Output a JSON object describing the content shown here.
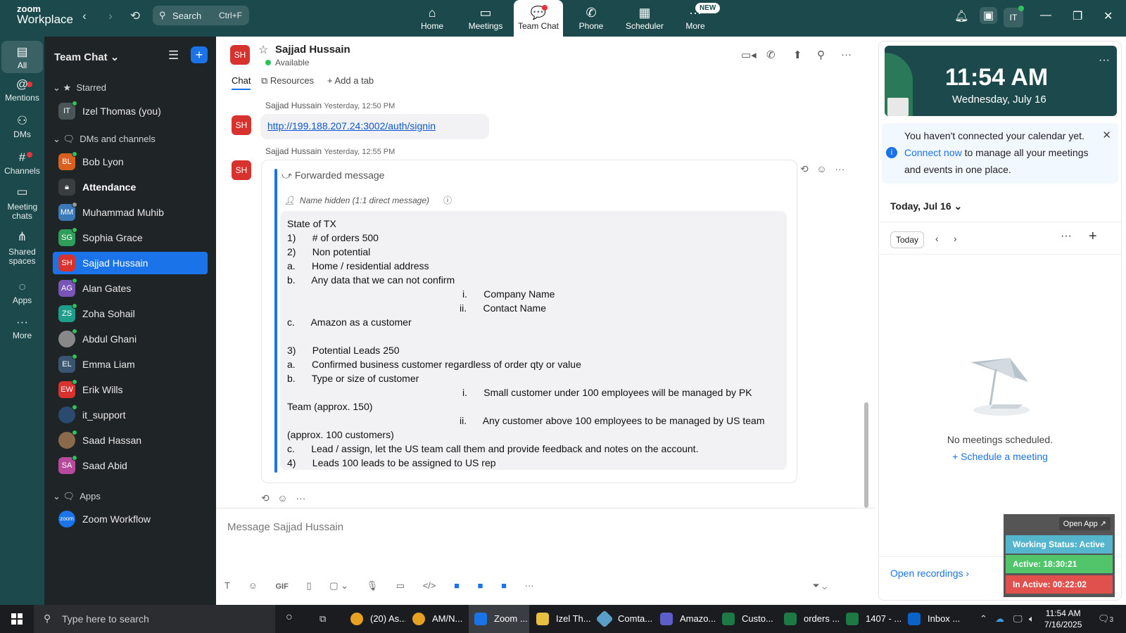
{
  "topbar": {
    "brand_line1": "zoom",
    "brand_line2": "Workplace",
    "search_label": "Search",
    "search_shortcut": "Ctrl+F",
    "nav": [
      {
        "label": "Home"
      },
      {
        "label": "Meetings"
      },
      {
        "label": "Team Chat"
      },
      {
        "label": "Phone"
      },
      {
        "label": "Scheduler"
      },
      {
        "label": "More"
      }
    ],
    "new_badge": "NEW",
    "avatar": "IT"
  },
  "rail": [
    {
      "label": "All"
    },
    {
      "label": "Mentions"
    },
    {
      "label": "DMs"
    },
    {
      "label": "Channels"
    },
    {
      "label": "Meeting chats"
    },
    {
      "label": "Shared spaces"
    },
    {
      "label": "Apps"
    },
    {
      "label": "More"
    }
  ],
  "sidebar": {
    "title": "Team Chat",
    "sections": {
      "starred": "Starred",
      "dms": "DMs and channels",
      "apps": "Apps"
    },
    "starred_items": [
      {
        "initials": "IT",
        "name": "Izel Thomas (you)",
        "color": "#4a5558"
      }
    ],
    "dm_items": [
      {
        "initials": "BL",
        "name": "Bob Lyon",
        "color": "#d9601e"
      },
      {
        "initials": "",
        "name": "Attendance",
        "color": "#3a3e40"
      },
      {
        "initials": "MM",
        "name": "Muhammad Muhib",
        "color": "#3a78b8"
      },
      {
        "initials": "SG",
        "name": "Sophia Grace",
        "color": "#2e9e5a"
      },
      {
        "initials": "SH",
        "name": "Sajjad Hussain",
        "color": "#d7322e"
      },
      {
        "initials": "AG",
        "name": "Alan Gates",
        "color": "#7a55b8"
      },
      {
        "initials": "ZS",
        "name": "Zoha Sohail",
        "color": "#1e9e8a"
      },
      {
        "initials": "",
        "name": "Abdul Ghani",
        "color": "#888888"
      },
      {
        "initials": "EL",
        "name": "Emma Liam",
        "color": "#3a5570"
      },
      {
        "initials": "EW",
        "name": "Erik Wills",
        "color": "#d7322e"
      },
      {
        "initials": "",
        "name": "it_support",
        "color": "#2a4a70"
      },
      {
        "initials": "",
        "name": "Saad Hassan",
        "color": "#8a6a4a"
      },
      {
        "initials": "SA",
        "name": "Saad Abid",
        "color": "#b84a9e"
      }
    ],
    "app_items": [
      {
        "initials": "zoom",
        "name": "Zoom Workflow",
        "color": "#1a73e8"
      }
    ]
  },
  "chat": {
    "header_initials": "SH",
    "name": "Sajjad Hussain",
    "status": "Available",
    "tabs": [
      "Chat",
      "Resources",
      "Add a tab"
    ],
    "messages": [
      {
        "sender": "Sajjad Hussain",
        "time": "Yesterday, 12:50 PM",
        "initials": "SH",
        "link": "http://199.188.207.24:3002/auth/signin"
      },
      {
        "sender": "Sajjad Hussain",
        "time": "Yesterday, 12:55 PM",
        "initials": "SH"
      }
    ],
    "forwarded_label": "Forwarded message",
    "forwarded_source": "Name hidden (1:1 direct message)",
    "forwarded_body": "State of TX\n1)      # of orders 500\n2)      Non potential\na.      Home / residential address\nb.      Any data that we can not confirm\n                                                                i.      Company Name\n                                                               ii.      Contact Name\nc.      Amazon as a customer\n\n3)      Potential Leads 250\na.      Confirmed business customer regardless of order qty or value\nb.      Type or size of customer\n                                                                i.      Small customer under 100 employees will be managed by PK\nTeam (approx. 150)\n                                                               ii.      Any customer above 100 employees to be managed by US team\n(approx. 100 customers)\nc.      Lead / assign, let the US team call them and provide feedback and notes on the account.\n4)      Leads 100 leads to be assigned to US rep",
    "composer_placeholder": "Message Sajjad Hussain",
    "toolbar_gif": "GIF"
  },
  "calendar": {
    "time": "11:54 AM",
    "date": "Wednesday, July 16",
    "notice_pre": "You haven't connected your calendar yet.",
    "notice_link": "Connect now",
    "notice_post": "to manage all your meetings and events in one place.",
    "day_label": "Today, Jul 16",
    "today_button": "Today",
    "empty_text": "No meetings scheduled.",
    "schedule_link": "Schedule a meeting",
    "open_recordings": "Open recordings"
  },
  "work_widget": {
    "open_app": "Open App ↗",
    "status": "Working Status: Active",
    "active": "Active: 18:30:21",
    "inactive": "In Active: 00:22:02"
  },
  "taskbar": {
    "search_placeholder": "Type here to search",
    "apps": [
      {
        "label": "(20) As...",
        "color": "#e8a020"
      },
      {
        "label": "AM/N...",
        "color": "#e8a020"
      },
      {
        "label": "Zoom ...",
        "color": "#1a73e8"
      },
      {
        "label": "Izel Th...",
        "color": "#e8c040"
      },
      {
        "label": "Comta...",
        "color": "#5a9ec8"
      },
      {
        "label": "Amazo...",
        "color": "#5b5fc7"
      },
      {
        "label": "Custo...",
        "color": "#1e7a44"
      },
      {
        "label": "orders ...",
        "color": "#1e7a44"
      },
      {
        "label": "1407 - ...",
        "color": "#1e7a44"
      },
      {
        "label": "Inbox ...",
        "color": "#0a64c8"
      }
    ],
    "time": "11:54 AM",
    "date": "7/16/2025",
    "notif_count": "3"
  }
}
